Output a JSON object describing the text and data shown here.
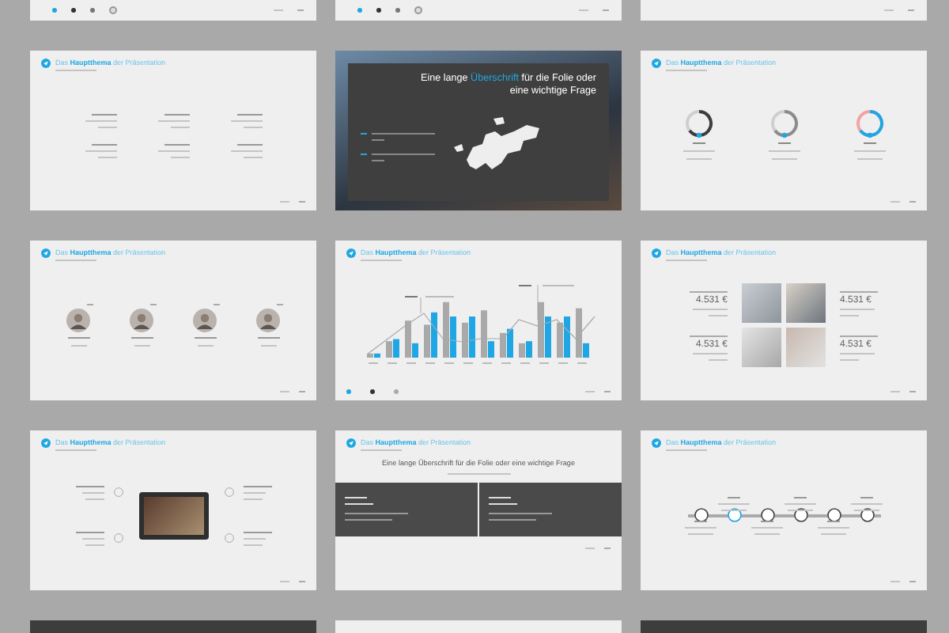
{
  "top_row": [
    {
      "legend": true
    },
    {
      "legend": true
    },
    {
      "legend": false
    }
  ],
  "slides": [
    {
      "kind": "points",
      "title": "Das **Hauptthema** der Präsentation"
    },
    {
      "kind": "map",
      "headline": "Eine lange **Überschrift** für die Folie oder eine wichtige Frage"
    },
    {
      "kind": "donuts",
      "title": "Das **Hauptthema** der Präsentation"
    },
    {
      "kind": "team",
      "title": "Das **Hauptthema** der Präsentation"
    },
    {
      "kind": "chart",
      "title": "Das **Hauptthema** der Präsentation"
    },
    {
      "kind": "prices",
      "title": "Das **Hauptthema** der Präsentation",
      "prices": [
        "4.531 €",
        "4.531 €",
        "4.531 €",
        "4.531 €"
      ]
    },
    {
      "kind": "video",
      "title": "Das **Hauptthema** der Präsentation"
    },
    {
      "kind": "photos",
      "title": "Das **Hauptthema** der Präsentation",
      "headline": "Eine lange Überschrift für die Folie oder eine wichtige Frage"
    },
    {
      "kind": "timeline",
      "title": "Das **Hauptthema** der Präsentation",
      "nodes": [
        {
          "selected": false
        },
        {
          "selected": true
        },
        {
          "selected": false
        },
        {
          "selected": false
        },
        {
          "selected": false
        },
        {
          "selected": false
        }
      ]
    }
  ],
  "bottom_row": [
    {
      "dark": true
    },
    {
      "dark": false
    },
    {
      "dark": true
    }
  ]
}
